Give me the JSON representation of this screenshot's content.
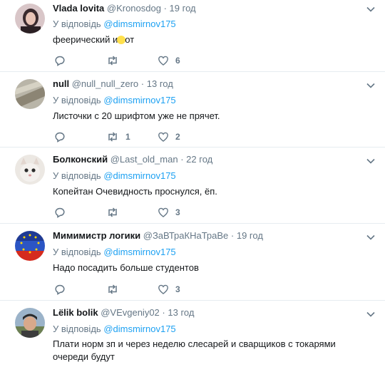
{
  "tweets": [
    {
      "name": "Vlada lovita",
      "handle": "@Kronosdog",
      "separator": "·",
      "time": "19 год",
      "reply_prefix": "У відповідь",
      "reply_to": "@dimsmirnov175",
      "text_before": "феерический и",
      "text_after": "от",
      "retweets": "",
      "likes": "6"
    },
    {
      "name": "null",
      "handle": "@null_null_zero",
      "separator": "·",
      "time": "13 год",
      "reply_prefix": "У відповідь",
      "reply_to": "@dimsmirnov175",
      "text": "Листочки с 20 шрифтом уже не прячет.",
      "retweets": "1",
      "likes": "2"
    },
    {
      "name": "Болконский",
      "handle": "@Last_old_man",
      "separator": "·",
      "time": "22 год",
      "reply_prefix": "У відповідь",
      "reply_to": "@dimsmirnov175",
      "text": "Копейтан Очевидность проснулся, ёп.",
      "retweets": "",
      "likes": "3"
    },
    {
      "name": "Мимимистр логики",
      "handle": "@ЗаВТраКНаТраВе",
      "separator": "·",
      "time": "19 год",
      "reply_prefix": "У відповідь",
      "reply_to": "@dimsmirnov175",
      "text": "Надо посадить больше студентов",
      "retweets": "",
      "likes": "3"
    },
    {
      "name": "Lëlik bolik",
      "handle": "@VEvgeniy02",
      "separator": "·",
      "time": "13 год",
      "reply_prefix": "У відповідь",
      "reply_to": "@dimsmirnov175",
      "text": "Плати норм зп и через неделю слесарей и сварщиков с токарями очереди будут"
    }
  ],
  "colors": {
    "link": "#1da1f2",
    "muted": "#657786",
    "divider": "#e6ecf0",
    "highlight": "#ffe04d"
  }
}
